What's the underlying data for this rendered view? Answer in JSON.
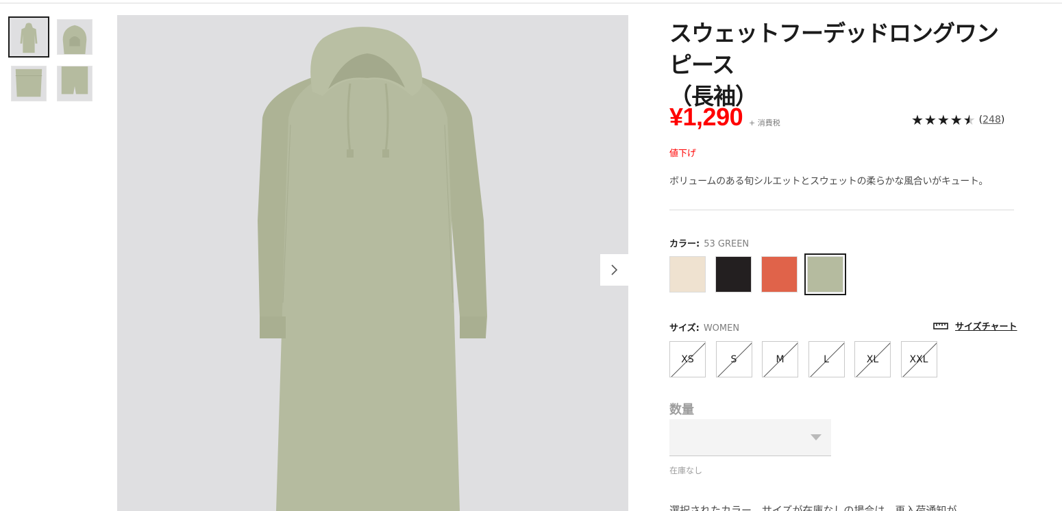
{
  "product": {
    "title_line1": "スウェットフーデッドロングワンピース",
    "title_line2": "（長袖）",
    "price": "¥1,290",
    "tax_note": "+ 消費税",
    "rating": 4.5,
    "review_count": "248",
    "price_tag": "値下げ",
    "description": "ボリュームのある旬シルエットとスウェットの柔らかな風合いがキュート。"
  },
  "gallery": {
    "thumbnails": [
      {
        "icon": "dress-front-thumbnail"
      },
      {
        "icon": "hood-detail-thumbnail"
      },
      {
        "icon": "fabric-detail-thumbnail"
      },
      {
        "icon": "hem-detail-thumbnail"
      }
    ],
    "next_icon": "chevron-right-icon"
  },
  "color": {
    "label": "カラー:",
    "selected": "53 GREEN",
    "swatches": [
      "#efe2d0",
      "#231f20",
      "#e0634a",
      "#b5bb9f"
    ],
    "selected_index": 3
  },
  "size": {
    "label": "サイズ:",
    "category": "WOMEN",
    "chart_label": "サイズチャート",
    "chart_icon": "ruler-icon",
    "options": [
      "XS",
      "S",
      "M",
      "L",
      "XL",
      "XXL"
    ]
  },
  "quantity": {
    "label": "数量",
    "stock": "在庫なし"
  },
  "notice": "選択されたカラー、サイズが在庫なしの場合は、再入荷通知が"
}
